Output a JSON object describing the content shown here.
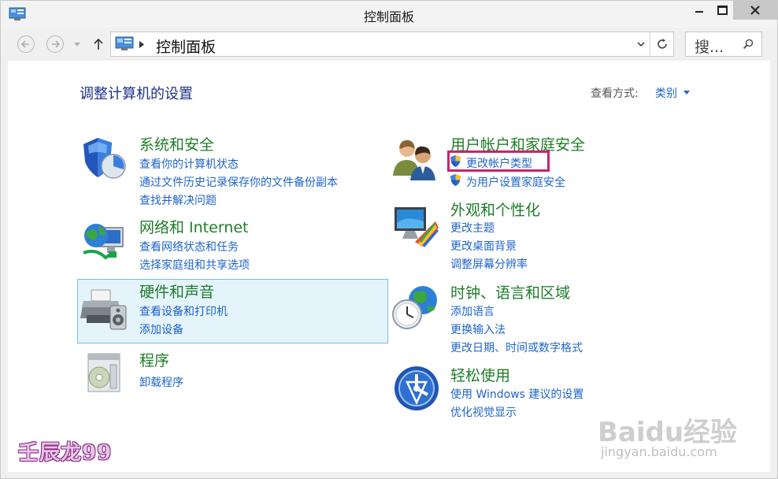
{
  "window": {
    "title": "控制面板"
  },
  "navbar": {
    "address": "控制面板",
    "search_placeholder": "搜..."
  },
  "header": {
    "page_title": "调整计算机的设置",
    "view_label": "查看方式:",
    "view_value": "类别"
  },
  "categories_left": [
    {
      "title": "系统和安全",
      "icon": "shield-icon",
      "links": [
        "查看你的计算机状态",
        "通过文件历史记录保存你的文件备份副本",
        "查找并解决问题"
      ]
    },
    {
      "title": "网络和 Internet",
      "icon": "network-icon",
      "links": [
        "查看网络状态和任务",
        "选择家庭组和共享选项"
      ]
    },
    {
      "title": "硬件和声音",
      "icon": "printer-icon",
      "links": [
        "查看设备和打印机",
        "添加设备"
      ]
    },
    {
      "title": "程序",
      "icon": "programs-icon",
      "links": [
        "卸载程序"
      ]
    }
  ],
  "categories_right": [
    {
      "title": "用户帐户和家庭安全",
      "icon": "users-icon",
      "links": [
        "更改帐户类型",
        "为用户设置家庭安全"
      ]
    },
    {
      "title": "外观和个性化",
      "icon": "monitor-palette-icon",
      "links": [
        "更改主题",
        "更改桌面背景",
        "调整屏幕分辨率"
      ]
    },
    {
      "title": "时钟、语言和区域",
      "icon": "clock-globe-icon",
      "links": [
        "添加语言",
        "更换输入法",
        "更改日期、时间或数字格式"
      ]
    },
    {
      "title": "轻松使用",
      "icon": "accessibility-icon",
      "links": [
        "使用 Windows 建议的设置",
        "优化视觉显示"
      ]
    }
  ],
  "watermarks": {
    "left": "壬辰龙99",
    "brand": "Baidu经验",
    "url": "jingyan.baidu.com"
  },
  "colors": {
    "category_title": "#1e7d28",
    "link": "#1e64c8",
    "page_title": "#1e3287",
    "hover_bg": "#e5f3fb",
    "highlight": "#c8246a"
  }
}
